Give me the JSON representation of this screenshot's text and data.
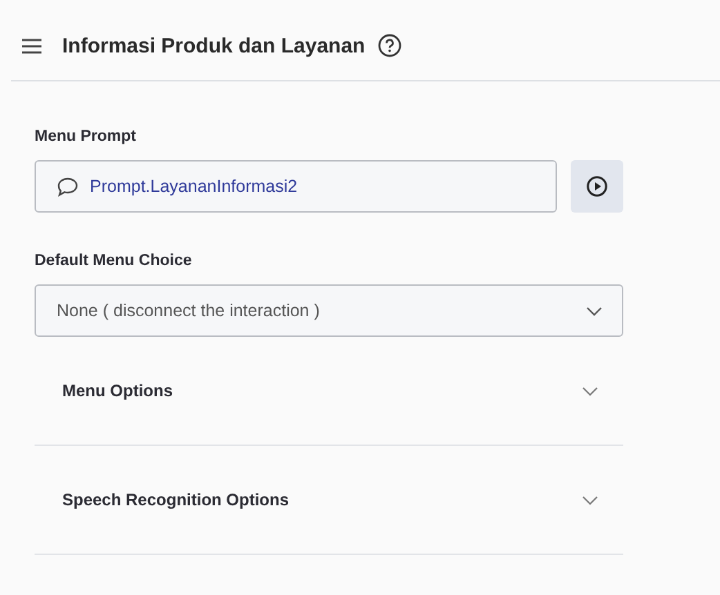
{
  "header": {
    "title": "Informasi Produk dan Layanan"
  },
  "menu_prompt": {
    "label": "Menu Prompt",
    "value": "Prompt.LayananInformasi2"
  },
  "default_menu_choice": {
    "label": "Default Menu Choice",
    "value": "None ( disconnect the interaction )"
  },
  "sections": [
    {
      "title": "Menu Options",
      "expanded": false
    },
    {
      "title": "Speech Recognition Options",
      "expanded": false
    }
  ]
}
